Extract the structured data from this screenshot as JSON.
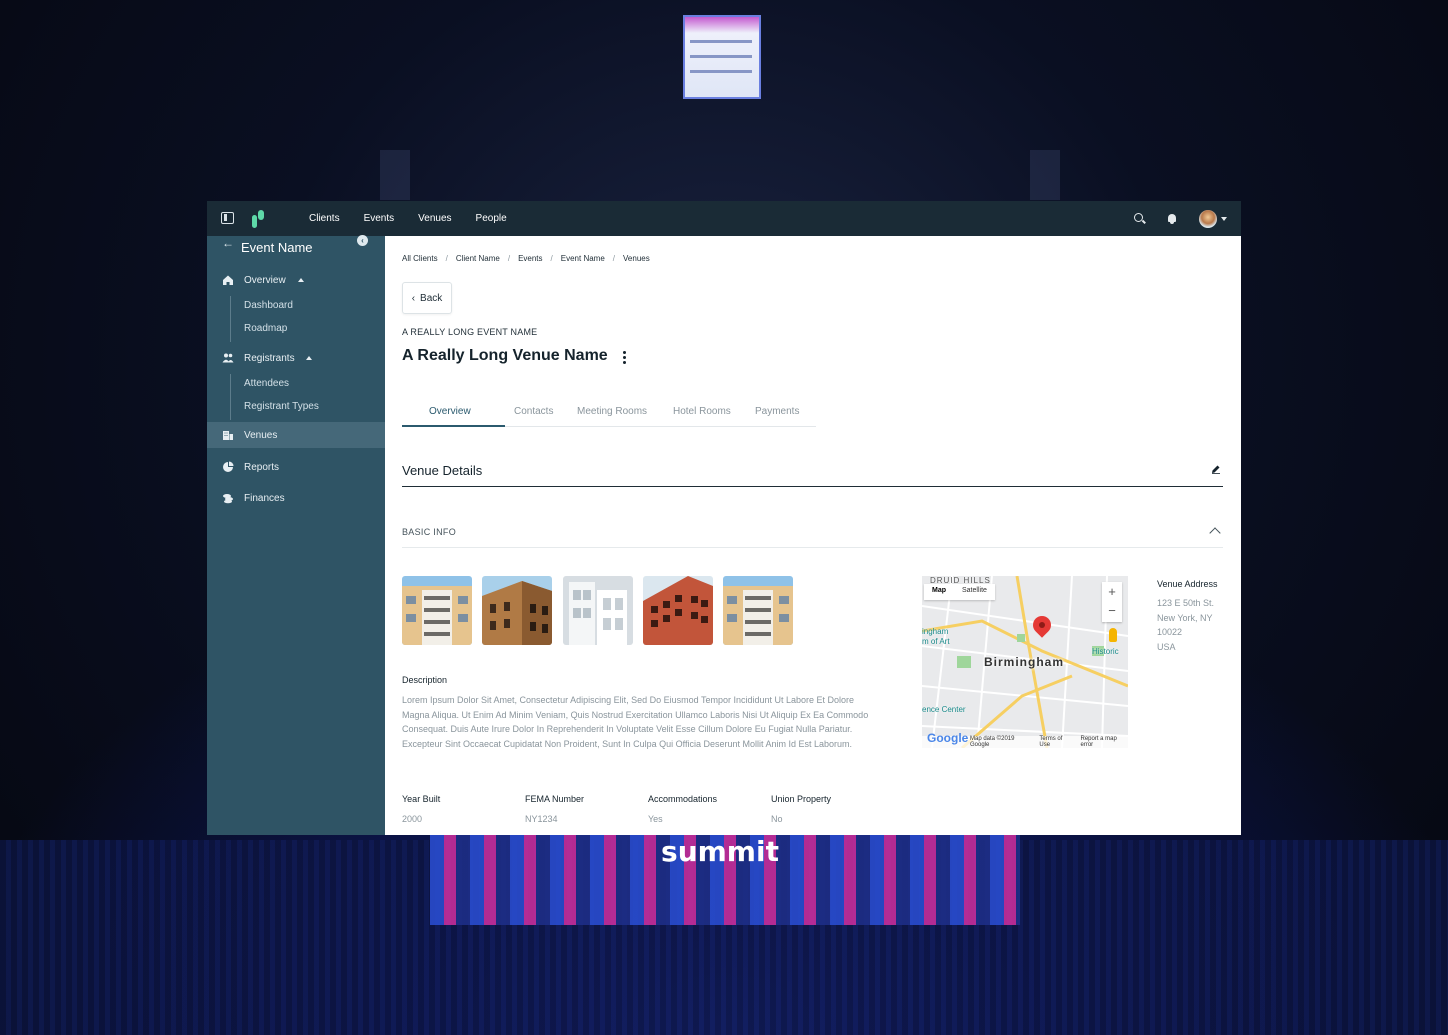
{
  "colors": {
    "topbar": "#1a2b36",
    "sidebar": "#2f5465",
    "sidebar_active": "#456879",
    "accent": "#2b5a6e",
    "logo": "#5ed8a8",
    "map_pin": "#e53935"
  },
  "background": {
    "stage_text": "summit"
  },
  "topbar": {
    "nav": [
      "Clients",
      "Events",
      "Venues",
      "People"
    ]
  },
  "sidebar": {
    "event_name": "Event Name",
    "items": [
      {
        "label": "Overview",
        "icon": "home-icon",
        "expanded": true
      },
      {
        "label": "Registrants",
        "icon": "people-icon",
        "expanded": true
      },
      {
        "label": "Venues",
        "icon": "building-icon",
        "active": true
      },
      {
        "label": "Reports",
        "icon": "pie-chart-icon"
      },
      {
        "label": "Finances",
        "icon": "coins-icon"
      }
    ],
    "overview_sub": [
      "Dashboard",
      "Roadmap"
    ],
    "registrants_sub": [
      "Attendees",
      "Registrant Types"
    ]
  },
  "breadcrumb": [
    "All Clients",
    "Client Name",
    "Events",
    "Event Name",
    "Venues"
  ],
  "back_label": "Back",
  "event_caption": "A REALLY LONG EVENT NAME",
  "venue_title": "A Really Long Venue Name",
  "tabs": [
    "Overview",
    "Contacts",
    "Meeting Rooms",
    "Hotel Rooms",
    "Payments"
  ],
  "section_title": "Venue Details",
  "basic_info_label": "BASIC INFO",
  "description": {
    "label": "Description",
    "text": "Lorem Ipsum Dolor Sit Amet, Consectetur Adipiscing Elit, Sed Do Eiusmod Tempor Incididunt Ut Labore Et Dolore Magna Aliqua. Ut Enim Ad Minim Veniam, Quis Nostrud Exercitation Ullamco Laboris Nisi Ut Aliquip Ex Ea Commodo Consequat. Duis Aute Irure Dolor In Reprehenderit In Voluptate Velit Esse Cillum Dolore Eu Fugiat Nulla Pariatur. Excepteur Sint Occaecat Cupidatat Non Proident, Sunt In Culpa Qui Officia Deserunt Mollit Anim Id Est Laborum."
  },
  "facts": [
    {
      "label": "Year Built",
      "value": "2000"
    },
    {
      "label": "FEMA Number",
      "value": "NY1234"
    },
    {
      "label": "Accommodations",
      "value": "Yes"
    },
    {
      "label": "Union Property",
      "value": "No"
    }
  ],
  "map": {
    "toggle": [
      "Map",
      "Satellite"
    ],
    "city": "Birmingham",
    "top_label": "DRUID HILLS",
    "labels": [
      "ingham",
      "m of Art",
      "Historic",
      "ence Center"
    ],
    "footer": [
      "Map data ©2019 Google",
      "Terms of Use",
      "Report a map error"
    ],
    "google": "Google",
    "zoom_in": "+",
    "zoom_out": "−"
  },
  "address": {
    "label": "Venue Address",
    "line1": "123 E 50th St.",
    "line2": "New York, NY",
    "line3": "10022",
    "line4": "USA"
  }
}
